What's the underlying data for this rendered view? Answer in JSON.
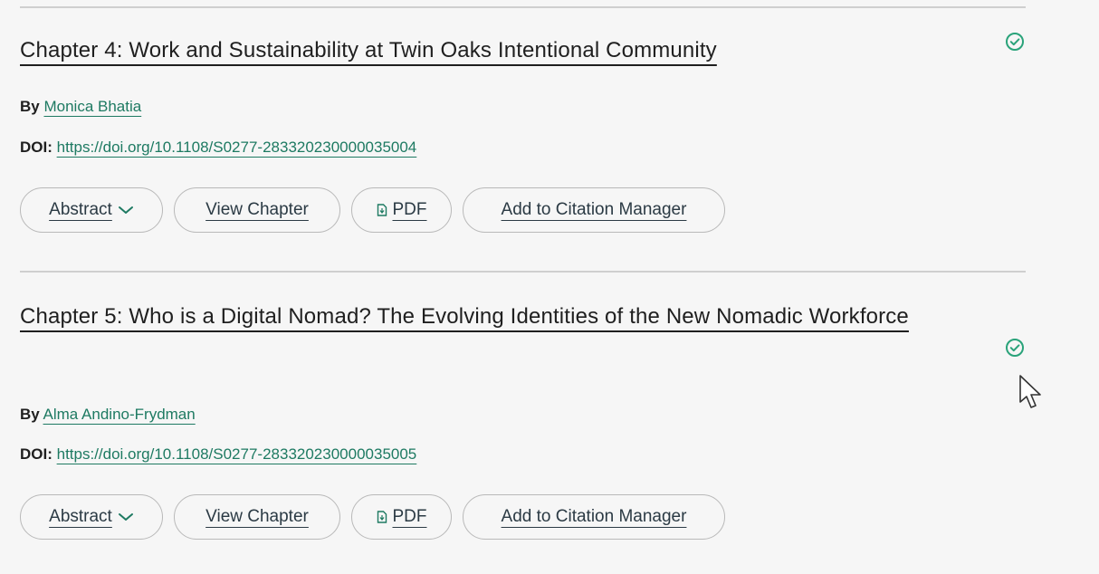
{
  "colors": {
    "accent": "#1e7a62",
    "check": "#2aa37a",
    "divider": "#cfcfcf",
    "background": "#f6f6f6"
  },
  "chapters": [
    {
      "title": "Chapter 4: Work and Sustainability at Twin Oaks Intentional Community",
      "by_label": "By",
      "author": "Monica Bhatia",
      "doi_label": "DOI:",
      "doi": "https://doi.org/10.1108/S0277-283320230000035004",
      "status_icon": "check-circle-icon",
      "buttons": {
        "abstract": "Abstract",
        "view": "View Chapter",
        "pdf": "PDF",
        "cite": "Add to Citation Manager"
      }
    },
    {
      "title": "Chapter 5: Who is a Digital Nomad? The Evolving Identities of the New Nomadic Workforce",
      "by_label": "By",
      "author": "Alma Andino-Frydman",
      "doi_label": "DOI:",
      "doi": "https://doi.org/10.1108/S0277-283320230000035005",
      "status_icon": "check-circle-icon",
      "buttons": {
        "abstract": "Abstract",
        "view": "View Chapter",
        "pdf": "PDF",
        "cite": "Add to Citation Manager"
      }
    }
  ]
}
